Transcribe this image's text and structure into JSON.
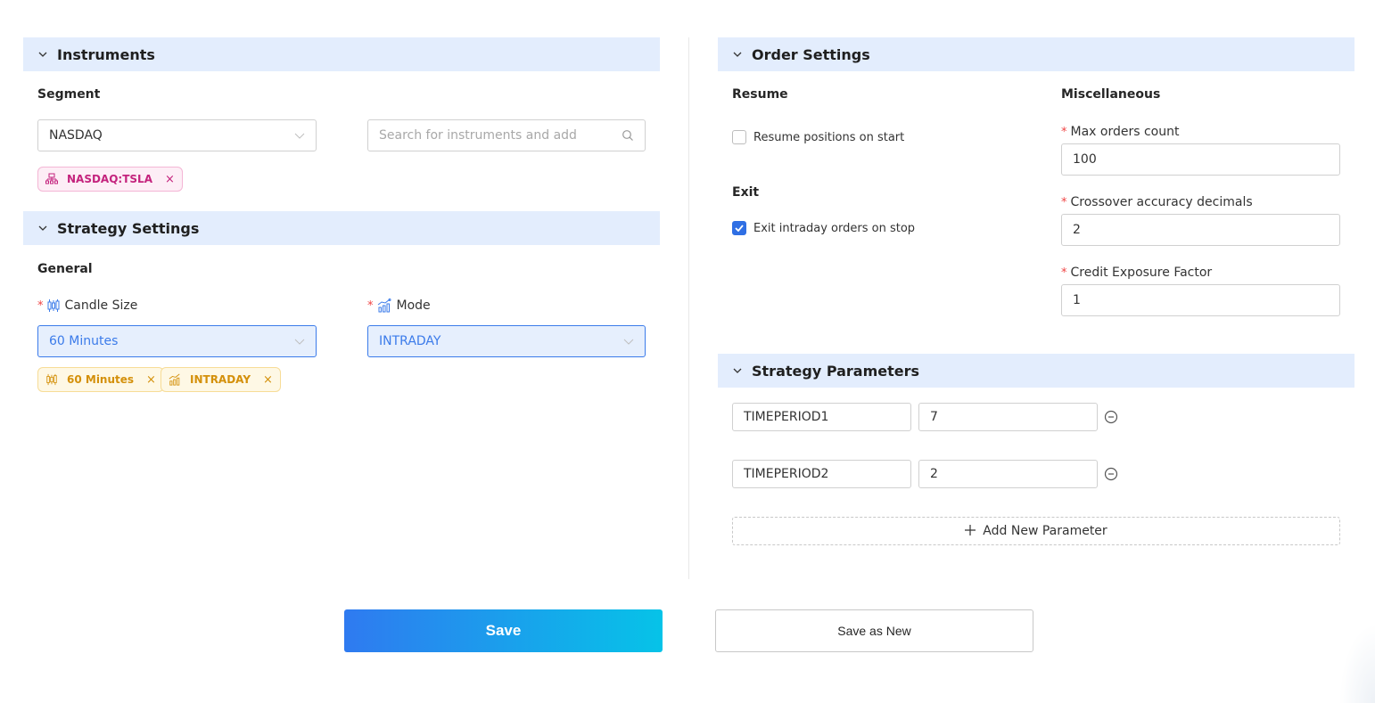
{
  "instruments": {
    "title": "Instruments",
    "segment_label": "Segment",
    "segment_value": "NASDAQ",
    "search_placeholder": "Search for instruments and add",
    "tags": [
      {
        "label": "NASDAQ:TSLA",
        "icon": "exchange-tree-icon"
      }
    ]
  },
  "strategy_settings": {
    "title": "Strategy Settings",
    "general_label": "General",
    "candle_size_label": "Candle Size",
    "candle_size_value": "60 Minutes",
    "mode_label": "Mode",
    "mode_value": "INTRADAY",
    "required_mark": "*",
    "tags": [
      {
        "label": "60 Minutes",
        "icon": "candlestick-icon"
      },
      {
        "label": "INTRADAY",
        "icon": "bar-chart-icon"
      }
    ]
  },
  "order_settings": {
    "title": "Order Settings",
    "resume_label": "Resume",
    "resume_checkbox": {
      "label": "Resume positions on start",
      "checked": false
    },
    "exit_label": "Exit",
    "exit_checkbox": {
      "label": "Exit intraday orders on stop",
      "checked": true
    },
    "misc_label": "Miscellaneous",
    "fields": [
      {
        "label": "Max orders count",
        "value": "100",
        "required": true
      },
      {
        "label": "Crossover accuracy decimals",
        "value": "2",
        "required": true
      },
      {
        "label": "Credit Exposure Factor",
        "value": "1",
        "required": true
      }
    ]
  },
  "strategy_parameters": {
    "title": "Strategy Parameters",
    "params": [
      {
        "name": "TIMEPERIOD1",
        "value": "7"
      },
      {
        "name": "TIMEPERIOD2",
        "value": "2"
      }
    ],
    "add_label": "Add New Parameter"
  },
  "actions": {
    "save_label": "Save",
    "save_new_label": "Save as New"
  },
  "colors": {
    "accent": "#2f6fe4",
    "panel_header_bg": "#e3edfd",
    "tag_pink": "#c4237d",
    "tag_yellow": "#d4900a",
    "required": "#ef4444"
  }
}
